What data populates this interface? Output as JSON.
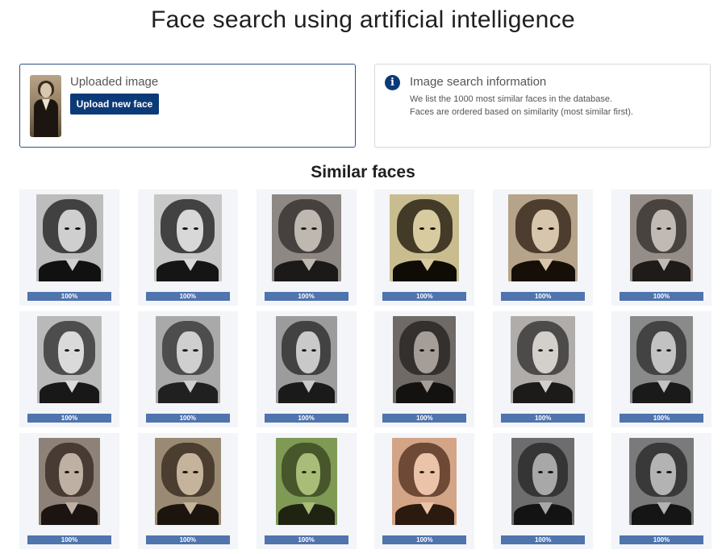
{
  "page": {
    "title": "Face search using artificial intelligence"
  },
  "upload": {
    "label": "Uploaded image",
    "button_label": "Upload new face"
  },
  "info": {
    "title": "Image search information",
    "line1": "We list the 1000 most similar faces in the database.",
    "line2": "Faces are ordered based on similarity (most similar first)."
  },
  "results": {
    "title": "Similar faces",
    "items": [
      {
        "similarity": "100%"
      },
      {
        "similarity": "100%"
      },
      {
        "similarity": "100%"
      },
      {
        "similarity": "100%"
      },
      {
        "similarity": "100%"
      },
      {
        "similarity": "100%"
      },
      {
        "similarity": "100%"
      },
      {
        "similarity": "100%"
      },
      {
        "similarity": "100%"
      },
      {
        "similarity": "100%"
      },
      {
        "similarity": "100%"
      },
      {
        "similarity": "100%"
      },
      {
        "similarity": "100%"
      },
      {
        "similarity": "100%"
      },
      {
        "similarity": "100%"
      },
      {
        "similarity": "100%"
      },
      {
        "similarity": "100%"
      },
      {
        "similarity": "100%"
      }
    ]
  },
  "colors": {
    "primary": "#0b3a78",
    "bar": "#4f74ae",
    "card_border": "#2e5388"
  }
}
